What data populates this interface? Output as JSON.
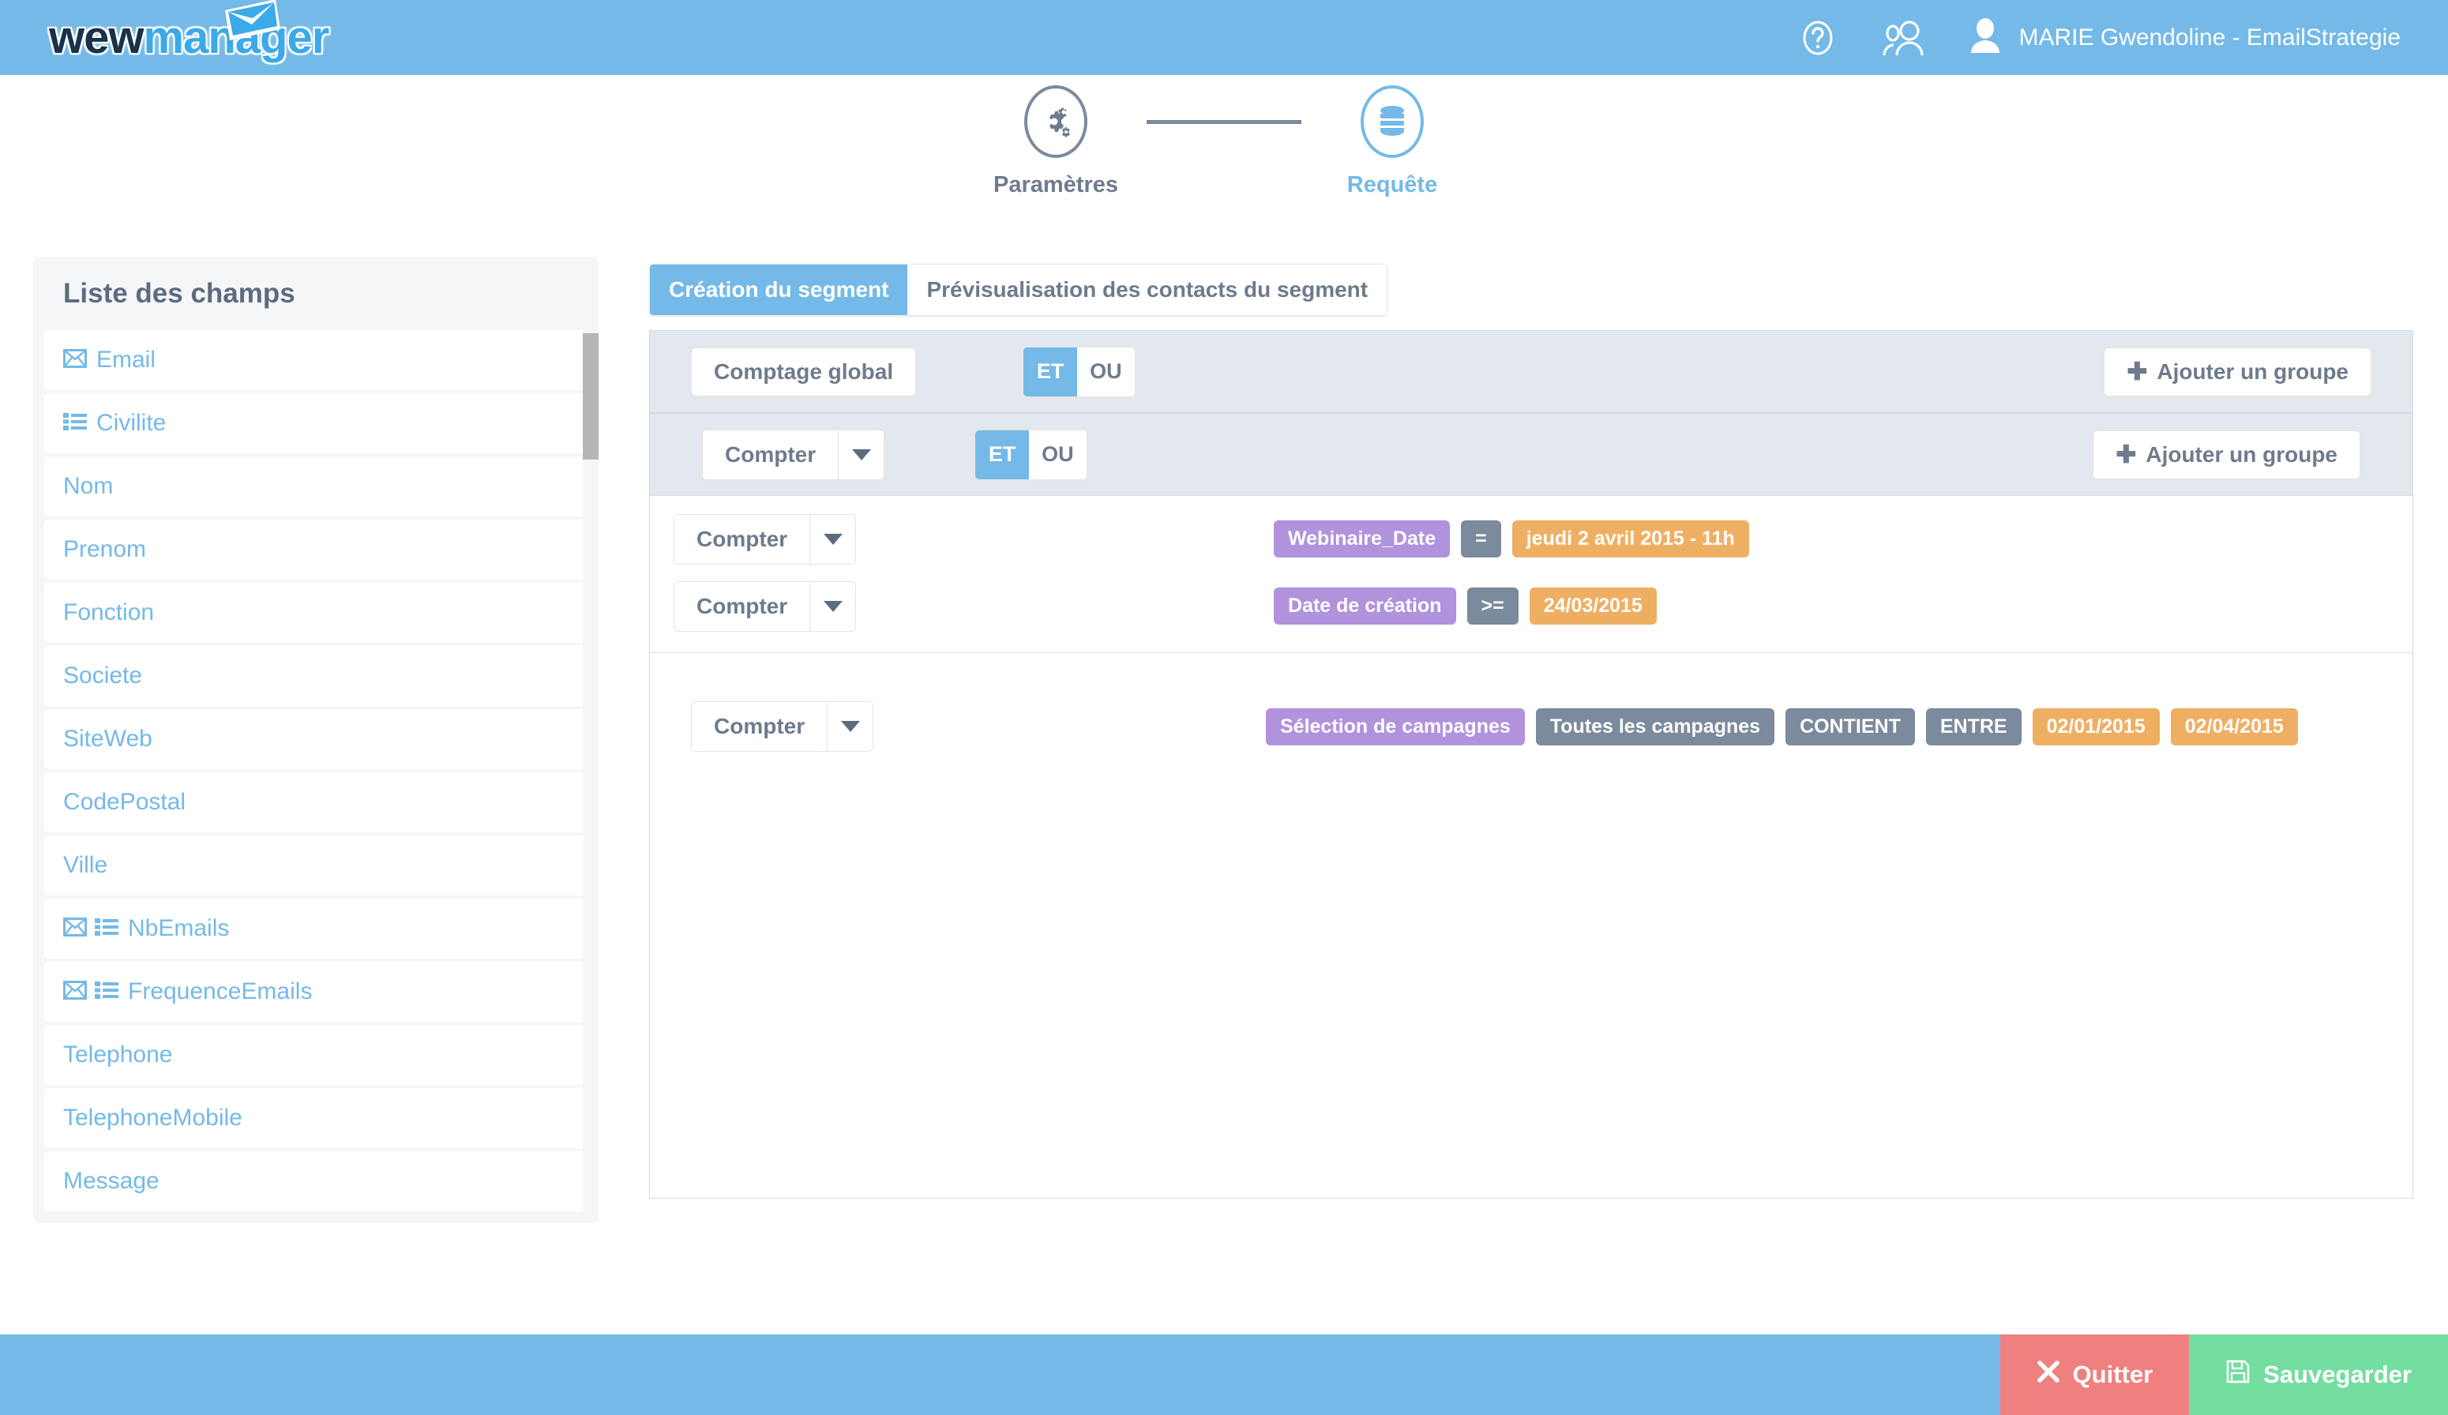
{
  "header": {
    "logo_part1": "wew",
    "logo_part2": "manager",
    "help_icon": "question-circle-icon",
    "users_icon": "users-icon",
    "avatar_icon": "user-avatar-icon",
    "user_name": "MARIE Gwendoline - EmailStrategie"
  },
  "stepper": {
    "steps": [
      {
        "label": "Paramètres",
        "icon": "gears-icon",
        "active": false
      },
      {
        "label": "Requête",
        "icon": "database-icon",
        "active": true
      }
    ]
  },
  "sidebar": {
    "title": "Liste des champs",
    "items": [
      {
        "label": "Email",
        "icons": [
          "envelope-icon"
        ]
      },
      {
        "label": "Civilite",
        "icons": [
          "list-icon"
        ]
      },
      {
        "label": "Nom",
        "icons": []
      },
      {
        "label": "Prenom",
        "icons": []
      },
      {
        "label": "Fonction",
        "icons": []
      },
      {
        "label": "Societe",
        "icons": []
      },
      {
        "label": "SiteWeb",
        "icons": []
      },
      {
        "label": "CodePostal",
        "icons": []
      },
      {
        "label": "Ville",
        "icons": []
      },
      {
        "label": "NbEmails",
        "icons": [
          "envelope-icon",
          "list-icon"
        ]
      },
      {
        "label": "FrequenceEmails",
        "icons": [
          "envelope-icon",
          "list-icon"
        ]
      },
      {
        "label": "Telephone",
        "icons": []
      },
      {
        "label": "TelephoneMobile",
        "icons": []
      },
      {
        "label": "Message",
        "icons": []
      }
    ]
  },
  "tabs": [
    {
      "label": "Création du segment",
      "active": true
    },
    {
      "label": "Prévisualisation des contacts du segment",
      "active": false
    }
  ],
  "toolbar_global": {
    "count_label": "Comptage global",
    "logic": {
      "and": "ET",
      "or": "OU",
      "selected": "ET"
    },
    "add_group_label": "Ajouter un groupe"
  },
  "group": {
    "count_label": "Compter",
    "logic": {
      "and": "ET",
      "or": "OU",
      "selected": "ET"
    },
    "add_group_label": "Ajouter un groupe",
    "conditions": [
      {
        "count_label": "Compter",
        "tags": [
          {
            "text": "Webinaire_Date",
            "kind": "field"
          },
          {
            "text": "=",
            "kind": "op"
          },
          {
            "text": "jeudi 2 avril 2015 - 11h",
            "kind": "value"
          }
        ]
      },
      {
        "count_label": "Compter",
        "tags": [
          {
            "text": "Date de création",
            "kind": "field"
          },
          {
            "text": ">=",
            "kind": "op"
          },
          {
            "text": "24/03/2015",
            "kind": "value"
          }
        ]
      }
    ]
  },
  "standalone_condition": {
    "count_label": "Compter",
    "tags": [
      {
        "text": "Sélection de campagnes",
        "kind": "field"
      },
      {
        "text": "Toutes les campagnes",
        "kind": "op"
      },
      {
        "text": "CONTIENT",
        "kind": "op"
      },
      {
        "text": "ENTRE",
        "kind": "op"
      },
      {
        "text": "02/01/2015",
        "kind": "value"
      },
      {
        "text": "02/04/2015",
        "kind": "value"
      }
    ]
  },
  "footer": {
    "quit_label": "Quitter",
    "quit_icon": "times-icon",
    "save_label": "Sauvegarder",
    "save_icon": "floppy-disk-icon"
  },
  "colors": {
    "brand_blue": "#74b9e7",
    "tag_field": "#b092dd",
    "tag_op": "#7b8a9c",
    "tag_value": "#efaf63",
    "quit_red": "#f08080",
    "save_green": "#74dda0"
  }
}
